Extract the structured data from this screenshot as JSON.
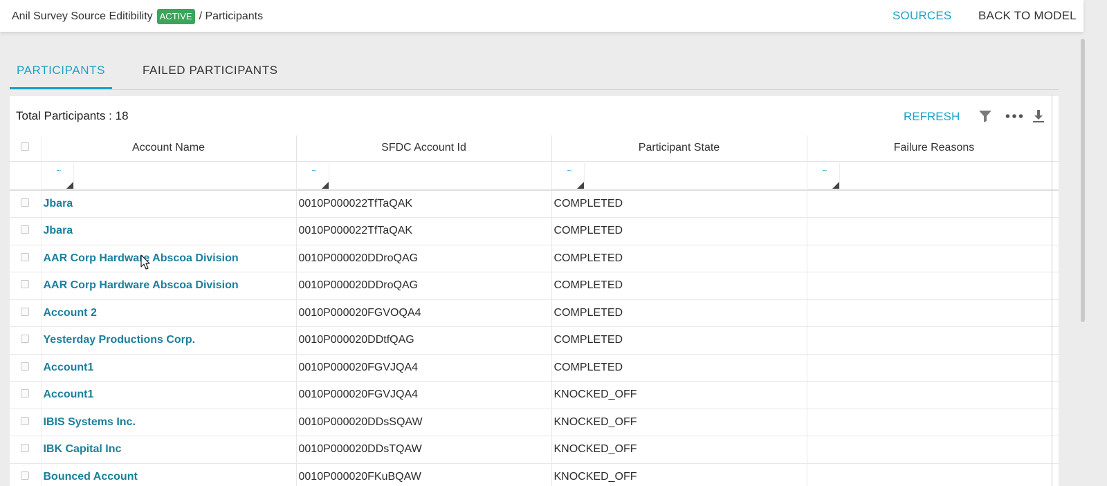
{
  "header": {
    "survey_name": "Anil Survey Source Editibility",
    "status_badge": "ACTIVE",
    "breadcrumb_tail": "/ Participants",
    "sources_label": "SOURCES",
    "back_label": "BACK TO MODEL"
  },
  "tabs": [
    {
      "label": "PARTICIPANTS",
      "active": true
    },
    {
      "label": "FAILED PARTICIPANTS",
      "active": false
    }
  ],
  "toolbar": {
    "total_label": "Total Participants : 18",
    "refresh_label": "REFRESH",
    "icons": [
      "filter-icon",
      "more-icon",
      "download-icon"
    ]
  },
  "table": {
    "columns": [
      "Account Name",
      "SFDC Account Id",
      "Participant State",
      "Failure Reasons"
    ],
    "filter_symbol": "~",
    "rows": [
      {
        "account": "Jbara",
        "sfdc": "0010P000022TfTaQAK",
        "state": "COMPLETED",
        "reason": ""
      },
      {
        "account": "Jbara",
        "sfdc": "0010P000022TfTaQAK",
        "state": "COMPLETED",
        "reason": ""
      },
      {
        "account": "AAR Corp Hardware Abscoa Division",
        "sfdc": "0010P000020DDroQAG",
        "state": "COMPLETED",
        "reason": ""
      },
      {
        "account": "AAR Corp Hardware Abscoa Division",
        "sfdc": "0010P000020DDroQAG",
        "state": "COMPLETED",
        "reason": ""
      },
      {
        "account": "Account 2",
        "sfdc": "0010P000020FGVOQA4",
        "state": "COMPLETED",
        "reason": ""
      },
      {
        "account": "Yesterday Productions Corp.",
        "sfdc": "0010P000020DDtfQAG",
        "state": "COMPLETED",
        "reason": ""
      },
      {
        "account": "Account1",
        "sfdc": "0010P000020FGVJQA4",
        "state": "COMPLETED",
        "reason": ""
      },
      {
        "account": "Account1",
        "sfdc": "0010P000020FGVJQA4",
        "state": "KNOCKED_OFF",
        "reason": ""
      },
      {
        "account": "IBIS Systems Inc.",
        "sfdc": "0010P000020DDsSQAW",
        "state": "KNOCKED_OFF",
        "reason": ""
      },
      {
        "account": "IBK Capital Inc",
        "sfdc": "0010P000020DDsTQAW",
        "state": "KNOCKED_OFF",
        "reason": ""
      },
      {
        "account": "Bounced Account",
        "sfdc": "0010P000020FKuBQAW",
        "state": "KNOCKED_OFF",
        "reason": ""
      }
    ]
  },
  "colors": {
    "accent": "#1aa3c8",
    "active_badge": "#3ba55c",
    "link": "#1a7f9c"
  }
}
